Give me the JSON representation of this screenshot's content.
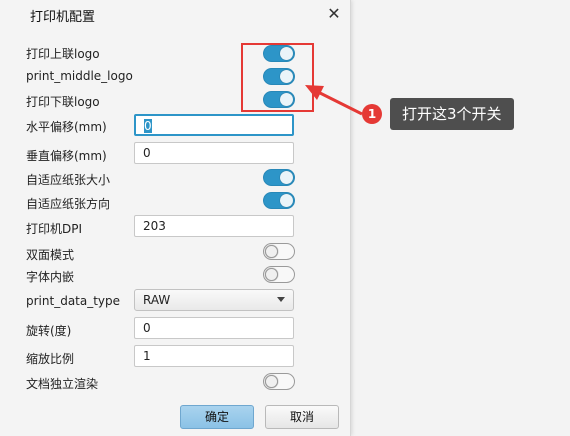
{
  "dialog": {
    "title": "打印机配置",
    "close_label": "✕"
  },
  "rows": {
    "print_top_logo": {
      "label": "打印上联logo",
      "on": true
    },
    "print_middle_logo": {
      "label": "print_middle_logo",
      "on": true
    },
    "print_bottom_logo": {
      "label": "打印下联logo",
      "on": true
    },
    "h_offset": {
      "label": "水平偏移(mm)",
      "value": "0"
    },
    "v_offset": {
      "label": "垂直偏移(mm)",
      "value": "0"
    },
    "auto_fit_size": {
      "label": "自适应纸张大小",
      "on": true
    },
    "auto_fit_orientation": {
      "label": "自适应纸张方向",
      "on": true
    },
    "dpi": {
      "label": "打印机DPI",
      "value": "203"
    },
    "duplex": {
      "label": "双面模式",
      "on": false
    },
    "embed_font": {
      "label": "字体内嵌",
      "on": false
    },
    "print_data_type": {
      "label": "print_data_type",
      "value": "RAW"
    },
    "rotation": {
      "label": "旋转(度)",
      "value": "0"
    },
    "scale": {
      "label": "缩放比例",
      "value": "1"
    },
    "standalone_render": {
      "label": "文档独立渲染",
      "on": false
    }
  },
  "buttons": {
    "ok": "确定",
    "cancel": "取消"
  },
  "annotation": {
    "step_number": "1",
    "tip_text": "打开这3个开关",
    "color": "#e53935"
  }
}
